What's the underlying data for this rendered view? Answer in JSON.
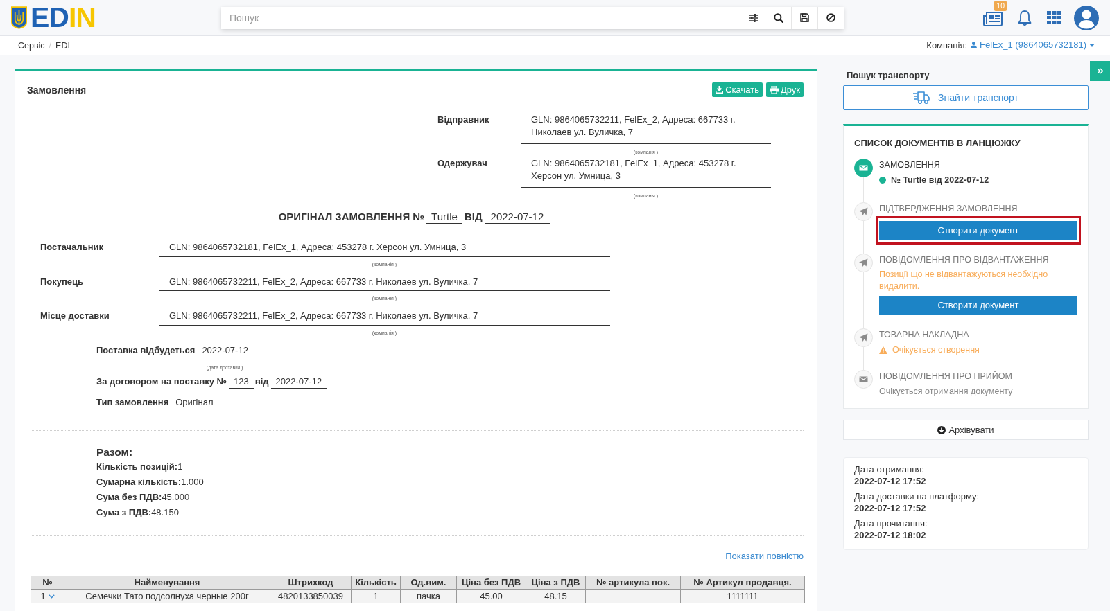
{
  "header": {
    "logo": {
      "primary": "ED",
      "accent": "IN"
    },
    "search": {
      "placeholder": "Пошук"
    },
    "news_badge": "10"
  },
  "breadcrumbs": {
    "items": [
      "Сервіс",
      "EDI"
    ],
    "separator": "/"
  },
  "company": {
    "label": "Компанія:",
    "value": "FelEx_1 (9864065732181)"
  },
  "document": {
    "title": "Замовлення",
    "actions": [
      {
        "label": "Скачать",
        "kind": "download"
      },
      {
        "label": "Друк",
        "kind": "print"
      }
    ],
    "parties": [
      {
        "label": "Відправник",
        "value": "GLN: 9864065732211, FelEx_2, Адреса: 667733 г. Николаев ул. Вуличка, 7",
        "hint": "(компанія )"
      },
      {
        "label": "Одержувач",
        "value": "GLN: 9864065732181, FelEx_1, Адреса: 453278 г. Херсон ул. Умница, 3",
        "hint": "(компанія )"
      }
    ],
    "heading": {
      "prefix": "ОРИГІНАЛ ЗАМОВЛЕННЯ №",
      "number": "Turtle",
      "date_word": "ВІД",
      "date": "2022-07-12"
    },
    "companies": [
      {
        "label": "Постачальник",
        "value": "GLN: 9864065732181, FelEx_1, Адреса: 453278 г. Херсон ул. Умница, 3",
        "hint": "(компанія )"
      },
      {
        "label": "Покупець",
        "value": "GLN: 9864065732211, FelEx_2, Адреса: 667733 г. Николаев ул. Вуличка, 7",
        "hint": "(компанія )"
      },
      {
        "label": "Місце доставки",
        "value": "GLN: 9864065732211, FelEx_2, Адреса: 667733 г. Николаев ул. Вуличка, 7",
        "hint": "(компанія )"
      }
    ],
    "delivery": {
      "label": "Поставка відбудеться",
      "value": "2022-07-12",
      "hint": "(дата доставки )"
    },
    "contract": {
      "label": "За договором на поставку №",
      "number": "123",
      "date_word": "від",
      "date": "2022-07-12"
    },
    "order_type": {
      "label": "Тип замовлення",
      "value": "Оригінал"
    },
    "totals": {
      "title": "Разом:",
      "items": [
        {
          "label": "Кількість позицій:",
          "value": "1"
        },
        {
          "label": "Сумарна кількість:",
          "value": "1.000"
        },
        {
          "label": "Сума без ПДВ:",
          "value": "45.000"
        },
        {
          "label": "Сума з ПДВ:",
          "value": "48.150"
        }
      ]
    },
    "show_all": "Показати повністю",
    "table": {
      "columns": [
        "№",
        "Найменування",
        "Штрихкод",
        "Кількість",
        "Од.вим.",
        "Ціна без ПДВ",
        "Ціна з ПДВ",
        "№ артикула пок.",
        "№ Артикул продавця."
      ],
      "rows": [
        {
          "expanded": false,
          "cells": [
            "1",
            "Семечки Тато подсолнуха черные 200г",
            "4820133850039",
            "1",
            "пачка",
            "45.00",
            "48.15",
            null,
            "1111111"
          ]
        }
      ]
    }
  },
  "transport": {
    "title": "Пошук транспорту",
    "button": "Знайти транспорт"
  },
  "chain": {
    "title": "СПИСОК ДОКУМЕНТІВ В ЛАНЦЮЖКУ",
    "items": [
      {
        "title": "ЗАМОВЛЕННЯ",
        "kind": "incoming",
        "completed": true,
        "status": {
          "kind": "reference",
          "text": "№ Turtle від 2022-07-12"
        }
      },
      {
        "title": "ПІДТВЕРДЖЕННЯ ЗАМОВЛЕННЯ",
        "kind": "outgoing",
        "completed": false,
        "action": {
          "label": "Створити документ",
          "highlighted": true
        }
      },
      {
        "title": "ПОВІДОМЛЕННЯ ПРО ВІДВАНТАЖЕННЯ",
        "kind": "outgoing",
        "completed": false,
        "status": {
          "kind": "warning",
          "text": "Позиції що не відвантажуються необхідно видалити."
        },
        "action": {
          "label": "Створити документ",
          "highlighted": false
        }
      },
      {
        "title": "ТОВАРНА НАКЛАДНА",
        "kind": "outgoing",
        "completed": false,
        "status": {
          "kind": "pending",
          "text": "Очікується створення"
        }
      },
      {
        "title": "ПОВІДОМЛЕННЯ ПРО ПРИЙОМ",
        "kind": "incoming",
        "completed": false,
        "status": {
          "kind": "muted",
          "text": "Очікується отримання документу"
        }
      }
    ]
  },
  "archive_button": "Архівувати",
  "dates": [
    {
      "label": "Дата отримання:",
      "value": "2022-07-12 17:52"
    },
    {
      "label": "Дата доставки на платформу:",
      "value": "2022-07-12 17:52"
    },
    {
      "label": "Дата прочитання:",
      "value": "2022-07-12 18:02"
    }
  ]
}
